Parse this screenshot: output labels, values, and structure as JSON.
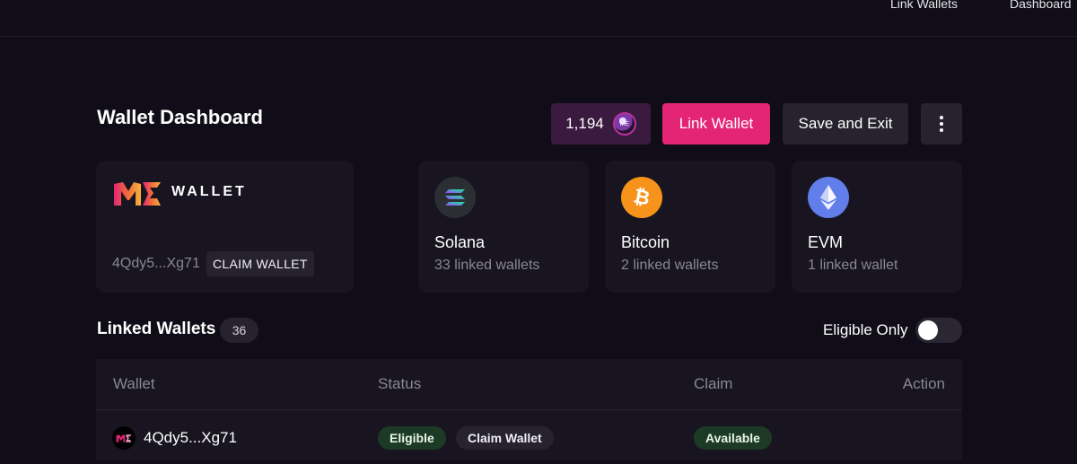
{
  "nav": {
    "link_wallets": "Link Wallets",
    "dashboard": "Dashboard"
  },
  "header": {
    "title": "Wallet Dashboard",
    "points": "1,194",
    "link_wallet": "Link Wallet",
    "save_exit": "Save and Exit"
  },
  "me_wallet": {
    "wordmark": "WALLET",
    "address": "4Qdy5...Xg71",
    "claim": "CLAIM WALLET"
  },
  "chains": [
    {
      "name": "Solana",
      "count": "33 linked wallets",
      "color": "#2b2f33"
    },
    {
      "name": "Bitcoin",
      "count": "2 linked wallets",
      "color": "#f7931a"
    },
    {
      "name": "EVM",
      "count": "1 linked wallet",
      "color": "#627eea"
    }
  ],
  "linked": {
    "title": "Linked Wallets",
    "count": "36",
    "eligible_only": "Eligible Only",
    "eligible_only_on": false
  },
  "table": {
    "headers": {
      "wallet": "Wallet",
      "status": "Status",
      "claim": "Claim",
      "action": "Action"
    },
    "rows": [
      {
        "wallet": "4Qdy5...Xg71",
        "status": "Eligible",
        "status_tag": "Claim Wallet",
        "claim": "Available"
      }
    ]
  },
  "colors": {
    "accent": "#e42575",
    "background": "#100d18",
    "card": "#181521"
  }
}
